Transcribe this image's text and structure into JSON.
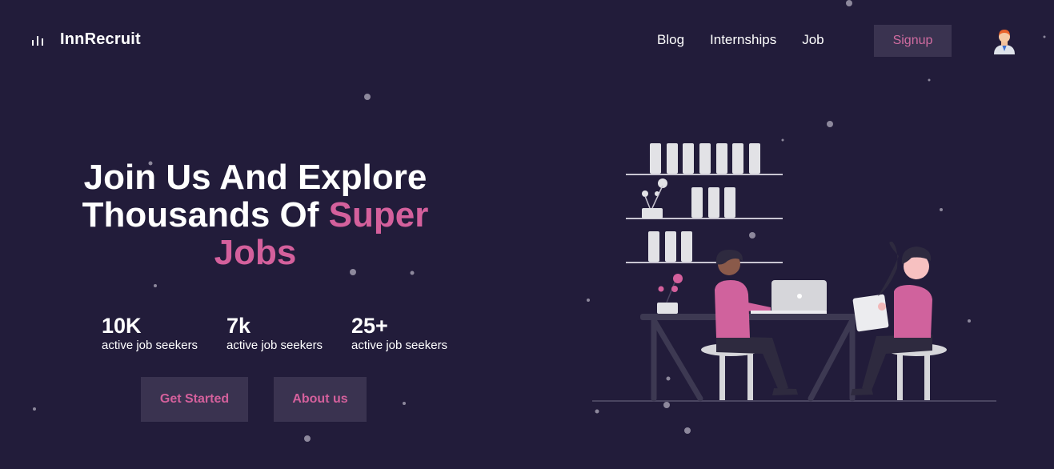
{
  "brand": {
    "name": "InnRecruit",
    "icon": "bar-chart-icon"
  },
  "nav": {
    "items": [
      "Blog",
      "Internships",
      "Job"
    ],
    "signup_label": "Signup",
    "avatar_icon": "user-avatar-icon"
  },
  "hero": {
    "title_line1": "Join Us And Explore",
    "title_line2_prefix": "Thousands Of ",
    "title_highlight_1": "Super",
    "title_highlight_2": "Jobs"
  },
  "stats": [
    {
      "value": "10K",
      "label": "active job seekers"
    },
    {
      "value": "7k",
      "label": "active job seekers"
    },
    {
      "value": "25+",
      "label": "active job seekers"
    }
  ],
  "buttons": {
    "get_started": "Get Started",
    "about": "About us"
  },
  "colors": {
    "background": "#221c3a",
    "accent": "#d4609c",
    "button_bg": "#3a3350",
    "text": "#ffffff"
  }
}
